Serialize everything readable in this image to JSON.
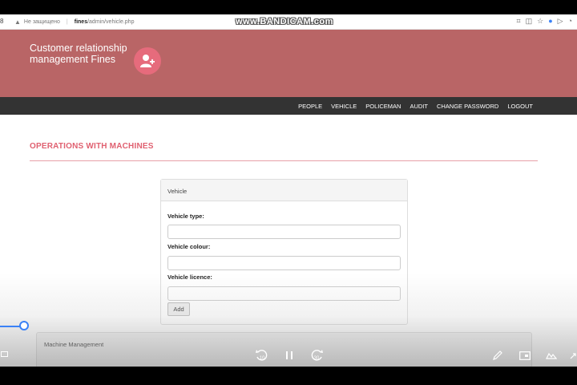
{
  "browser": {
    "security_warning": "Не защищено",
    "url_host": "fines",
    "url_path": "/admin/vehicle.php"
  },
  "recorder_watermark": "www.BANDICAM.com",
  "header": {
    "title": "Customer relationship management Fines",
    "avatar_icon": "user-add-icon",
    "background_color": "#b96566",
    "avatar_color": "#e66b7c"
  },
  "nav": {
    "items": [
      {
        "label": "PEOPLE"
      },
      {
        "label": "VEHICLE"
      },
      {
        "label": "POLICEMAN"
      },
      {
        "label": "AUDIT"
      },
      {
        "label": "CHANGE PASSWORD"
      },
      {
        "label": "LOGOUT"
      }
    ]
  },
  "main": {
    "section_title": "OPERATIONS WITH MACHINES",
    "accent_color": "#e06070",
    "vehicle_form": {
      "heading": "Vehicle",
      "fields": [
        {
          "label": "Vehicle type:",
          "value": ""
        },
        {
          "label": "Vehicle colour:",
          "value": ""
        },
        {
          "label": "Vehicle licence:",
          "value": ""
        }
      ],
      "add_label": "Add"
    },
    "management_panel": {
      "heading": "Machine Management"
    }
  },
  "player": {
    "rewind_label": "10",
    "forward_label": "30",
    "icons": [
      "pause-icon",
      "rewind-10-icon",
      "forward-30-icon",
      "pen-icon",
      "caption-icon",
      "fullscreen-icon"
    ]
  }
}
